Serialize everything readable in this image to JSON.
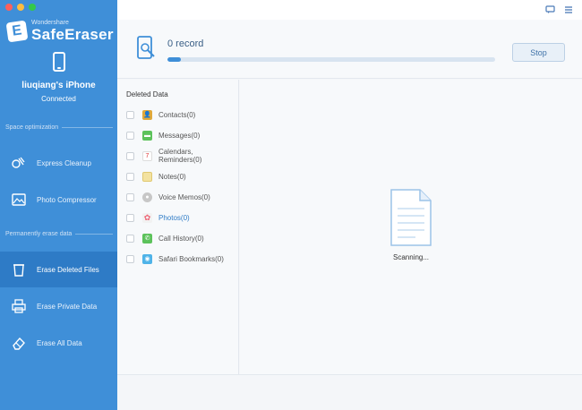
{
  "app": {
    "brand": "Wondershare",
    "name": "SafeEraser"
  },
  "device": {
    "name": "liuqiang's iPhone",
    "status": "Connected"
  },
  "sidebar": {
    "section1": "Space optimization",
    "section2": "Permanently erase data",
    "items": [
      {
        "label": "Express Cleanup",
        "icon": "broom-icon"
      },
      {
        "label": "Photo Compressor",
        "icon": "image-icon"
      },
      {
        "label": "Erase Deleted Files",
        "icon": "trash-icon"
      },
      {
        "label": "Erase Private Data",
        "icon": "printer-icon"
      },
      {
        "label": "Erase All Data",
        "icon": "eraser-icon"
      }
    ]
  },
  "scan": {
    "record_text": "0 record",
    "progress_fraction": 0.04,
    "stop_label": "Stop",
    "status_text": "Scanning..."
  },
  "list": {
    "header": "Deleted Data",
    "items": [
      {
        "label": "Contacts(0)",
        "icon": "contacts-icon",
        "color": "#e0a93b"
      },
      {
        "label": "Messages(0)",
        "icon": "messages-icon",
        "color": "#5cc25b"
      },
      {
        "label": "Calendars, Reminders(0)",
        "icon": "calendar-icon",
        "color": "#ffffff"
      },
      {
        "label": "Notes(0)",
        "icon": "notes-icon",
        "color": "#f3e2a0"
      },
      {
        "label": "Voice Memos(0)",
        "icon": "microphone-icon",
        "color": "#c7c7c7"
      },
      {
        "label": "Photos(0)",
        "icon": "photos-icon",
        "color": "#f2f2f2"
      },
      {
        "label": "Call History(0)",
        "icon": "phone-icon",
        "color": "#5cc25b"
      },
      {
        "label": "Safari Bookmarks(0)",
        "icon": "safari-icon",
        "color": "#4fb3e8"
      }
    ]
  },
  "colors": {
    "accent": "#3f8fd8",
    "sidebar_active": "#2e7bc6"
  }
}
